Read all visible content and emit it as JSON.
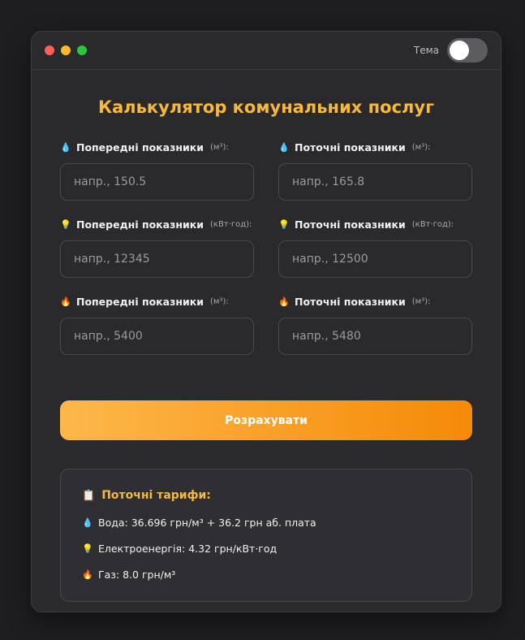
{
  "window": {
    "theme_label": "Тема"
  },
  "title": "Калькулятор комунальних послуг",
  "fields": [
    {
      "icon": "water-drop-icon",
      "glyph": "💧",
      "label": "Попередні показники",
      "unit": "(м³):",
      "placeholder": "напр., 150.5"
    },
    {
      "icon": "water-drop-icon",
      "glyph": "💧",
      "label": "Поточні показники",
      "unit": "(м³):",
      "placeholder": "напр., 165.8"
    },
    {
      "icon": "lightbulb-icon",
      "glyph": "💡",
      "label": "Попередні показники",
      "unit": "(кВт·год):",
      "placeholder": "напр., 12345"
    },
    {
      "icon": "lightbulb-icon",
      "glyph": "💡",
      "label": "Поточні показники",
      "unit": "(кВт·год):",
      "placeholder": "напр., 12500"
    },
    {
      "icon": "fire-icon",
      "glyph": "🔥",
      "label": "Попередні показники",
      "unit": "(м³):",
      "placeholder": "напр., 5400"
    },
    {
      "icon": "fire-icon",
      "glyph": "🔥",
      "label": "Поточні показники",
      "unit": "(м³):",
      "placeholder": "напр., 5480"
    }
  ],
  "calculate_button": "Розрахувати",
  "tariffs": {
    "title": "Поточні тарифи:",
    "title_glyph": "📋",
    "items": [
      {
        "icon": "water-drop-icon",
        "glyph": "💧",
        "text": "Вода: 36.696 грн/м³ + 36.2 грн аб. плата"
      },
      {
        "icon": "lightbulb-icon",
        "glyph": "💡",
        "text": "Електроенергія: 4.32 грн/кВт·год"
      },
      {
        "icon": "fire-icon",
        "glyph": "🔥",
        "text": "Газ: 8.0 грн/м³"
      }
    ]
  },
  "colors": {
    "accent": "#f6b93b",
    "button_start": "#fdb84a",
    "button_end": "#f58a07",
    "background": "#2a2a2d"
  }
}
